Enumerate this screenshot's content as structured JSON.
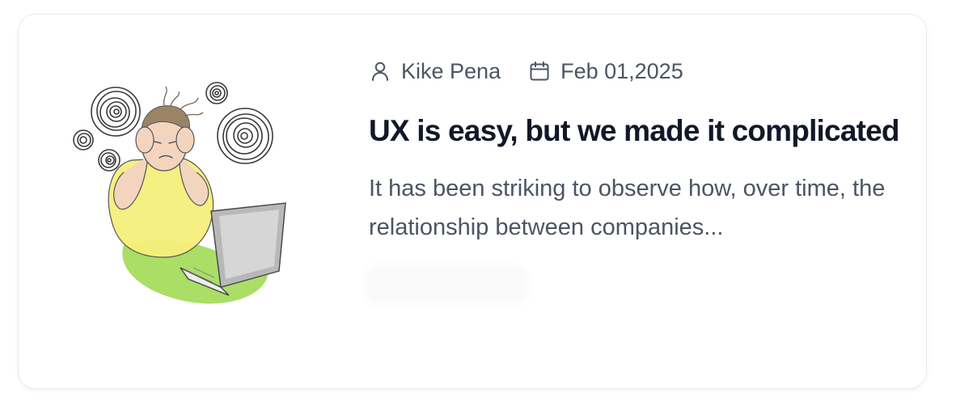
{
  "post": {
    "author": "Kike Pena",
    "date": "Feb 01,2025",
    "title": "UX is easy, but we made it complicated",
    "excerpt": "It has been striking to observe how, over time, the relationship between companies..."
  },
  "icons": {
    "author": "user-icon",
    "date": "calendar-icon"
  },
  "colors": {
    "title": "#111827",
    "text": "#4b5563",
    "card_border": "#ebebeb",
    "shirt": "#f5ee7a",
    "pants": "#9bd84a"
  }
}
